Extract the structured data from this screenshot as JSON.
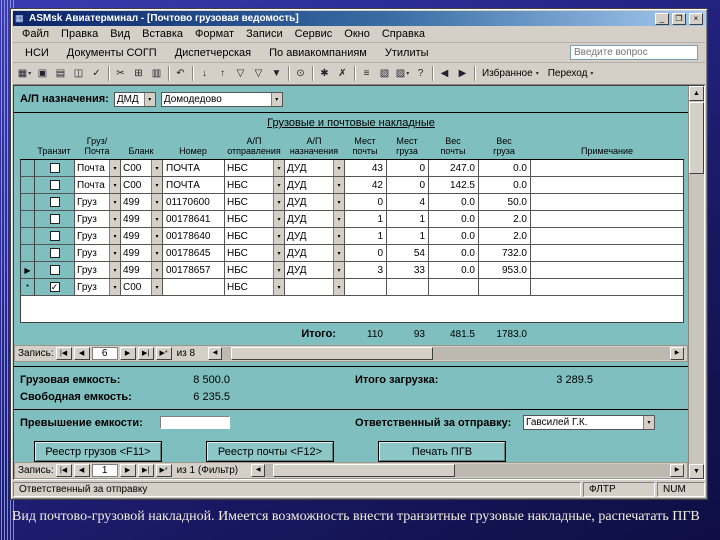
{
  "colors": {
    "slide_background": "#26268a",
    "form_background": "#7fbfbf",
    "titlebar_start": "#0a246a",
    "titlebar_end": "#a6caf0",
    "chrome": "#d4d0c8"
  },
  "window": {
    "title": "ASMsk Авиатерминал - [Почтово грузовая ведомость]",
    "app_icon_glyph": "▦",
    "controls": {
      "minimize": "_",
      "restore": "❐",
      "close": "×"
    }
  },
  "menubar": {
    "items": [
      "Файл",
      "Правка",
      "Вид",
      "Вставка",
      "Формат",
      "Записи",
      "Сервис",
      "Окно",
      "Справка"
    ]
  },
  "menubar2": {
    "items": [
      "НСИ",
      "Документы СОГП",
      "Диспетчерская",
      "По авиакомпаниям",
      "Утилиты"
    ],
    "search_placeholder": "Введите вопрос"
  },
  "toolbar": {
    "icons": [
      {
        "name": "view-icon",
        "glyph": "▦",
        "dropdown": true
      },
      {
        "name": "save-icon",
        "glyph": "▣"
      },
      {
        "name": "print-icon",
        "glyph": "▤"
      },
      {
        "name": "print-preview-icon",
        "glyph": "◫"
      },
      {
        "name": "spelling-icon",
        "glyph": "✓"
      },
      {
        "name": "separator"
      },
      {
        "name": "cut-icon",
        "glyph": "✂"
      },
      {
        "name": "copy-icon",
        "glyph": "⊞"
      },
      {
        "name": "paste-icon",
        "glyph": "▥"
      },
      {
        "name": "separator"
      },
      {
        "name": "undo-icon",
        "glyph": "↶"
      },
      {
        "name": "separator"
      },
      {
        "name": "sort-ascending-icon",
        "glyph": "↓"
      },
      {
        "name": "sort-descending-icon",
        "glyph": "↑"
      },
      {
        "name": "filter-by-selection-icon",
        "glyph": "▽"
      },
      {
        "name": "filter-by-form-icon",
        "glyph": "▽"
      },
      {
        "name": "apply-filter-icon",
        "glyph": "▼"
      },
      {
        "name": "separator"
      },
      {
        "name": "find-icon",
        "glyph": "⊙"
      },
      {
        "name": "separator"
      },
      {
        "name": "new-record-icon",
        "glyph": "✱"
      },
      {
        "name": "delete-record-icon",
        "glyph": "✗"
      },
      {
        "name": "separator"
      },
      {
        "name": "properties-icon",
        "glyph": "≡"
      },
      {
        "name": "database-window-icon",
        "glyph": "▧"
      },
      {
        "name": "new-object-icon",
        "glyph": "▨",
        "dropdown": true
      },
      {
        "name": "help-icon",
        "glyph": "?"
      },
      {
        "name": "separator"
      },
      {
        "name": "back-icon",
        "glyph": "◀"
      },
      {
        "name": "forward-icon",
        "glyph": "▶"
      },
      {
        "name": "separator"
      }
    ],
    "dropdowns": [
      {
        "name": "favorites-dropdown",
        "label": "Избранное"
      },
      {
        "name": "go-dropdown",
        "label": "Переход"
      }
    ]
  },
  "form": {
    "dest_label": "А/П назначения:",
    "dest_code": "ДМД",
    "dest_name": "Домодедово",
    "table_title": "Грузовые и почтовые накладные",
    "table": {
      "headers": [
        "Транзит",
        "Груз/\nПочта",
        "Бланк",
        "Номер",
        "А/П\nотправления",
        "А/П\nназначения",
        "Мест\nпочты",
        "Мест\nгруза",
        "Вес\nпочты",
        "Вес\nгруза",
        "Примечание"
      ],
      "rows": [
        {
          "marker": "",
          "transit": false,
          "type": "Почта",
          "blank": "C00",
          "number": "ПОЧТА",
          "from": "НБС",
          "to": "ДУД",
          "mest_pochty": "43",
          "mest_gruza": "0",
          "ves_pochty": "247.0",
          "ves_gruza": "0.0",
          "note": ""
        },
        {
          "marker": "",
          "transit": false,
          "type": "Почта",
          "blank": "C00",
          "number": "ПОЧТА",
          "from": "НБС",
          "to": "ДУД",
          "mest_pochty": "42",
          "mest_gruza": "0",
          "ves_pochty": "142.5",
          "ves_gruza": "0.0",
          "note": ""
        },
        {
          "marker": "",
          "transit": false,
          "type": "Груз",
          "blank": "499",
          "number": "01170600",
          "from": "НБС",
          "to": "ДУД",
          "mest_pochty": "0",
          "mest_gruza": "4",
          "ves_pochty": "0.0",
          "ves_gruza": "50.0",
          "note": ""
        },
        {
          "marker": "",
          "transit": false,
          "type": "Груз",
          "blank": "499",
          "number": "00178641",
          "from": "НБС",
          "to": "ДУД",
          "mest_pochty": "1",
          "mest_gruza": "1",
          "ves_pochty": "0.0",
          "ves_gruza": "2.0",
          "note": ""
        },
        {
          "marker": "",
          "transit": false,
          "type": "Груз",
          "blank": "499",
          "number": "00178640",
          "from": "НБС",
          "to": "ДУД",
          "mest_pochty": "1",
          "mest_gruza": "1",
          "ves_pochty": "0.0",
          "ves_gruza": "2.0",
          "note": ""
        },
        {
          "marker": "",
          "transit": false,
          "type": "Груз",
          "blank": "499",
          "number": "00178645",
          "from": "НБС",
          "to": "ДУД",
          "mest_pochty": "0",
          "mest_gruza": "54",
          "ves_pochty": "0.0",
          "ves_gruza": "732.0",
          "note": ""
        },
        {
          "marker": "▶",
          "transit": false,
          "type": "Груз",
          "blank": "499",
          "number": "00178657",
          "from": "НБС",
          "to": "ДУД",
          "mest_pochty": "3",
          "mest_gruza": "33",
          "ves_pochty": "0.0",
          "ves_gruza": "953.0",
          "note": ""
        },
        {
          "marker": "*",
          "transit": true,
          "type": "Груз",
          "blank": "C00",
          "number": "",
          "from": "НБС",
          "to": "",
          "mest_pochty": "",
          "mest_gruza": "",
          "ves_pochty": "",
          "ves_gruza": "",
          "note": ""
        }
      ],
      "totals": {
        "label": "Итого:",
        "mest_pochty": "110",
        "mest_gruza": "93",
        "ves_pochty": "481.5",
        "ves_gruza": "1783.0"
      }
    },
    "nav_top": {
      "label": "Запись:",
      "current": "6",
      "of": "из 8"
    },
    "capacity": {
      "cargo_label": "Грузовая емкость:",
      "cargo_value": "8 500.0",
      "free_label": "Свободная емкость:",
      "free_value": "6 235.5",
      "total_label": "Итого загрузка:",
      "total_value": "3 289.5",
      "excess_label": "Превышение емкости:",
      "responsible_label": "Ответственный за отправку:",
      "responsible_value": "Гавсилей  Г.К."
    },
    "buttons": [
      "Реестр грузов <F11>",
      "Реестр почты <F12>",
      "Печать ПГВ"
    ],
    "nav_bottom": {
      "label": "Запись:",
      "current": "1",
      "of": "из 1 (Фильтр)"
    }
  },
  "nav_glyphs": {
    "first": "|◀",
    "prev": "◀",
    "next": "▶",
    "last": "▶|",
    "new": "▶*"
  },
  "scroll_glyphs": {
    "left": "◀",
    "right": "▶",
    "up": "▲",
    "down": "▼"
  },
  "check_glyph": "✓",
  "combo_arrow": "▾",
  "statusbar": {
    "left": "Ответственный за отправку",
    "filter": "ФЛТР",
    "num": "NUM"
  },
  "caption": "Вид почтово-грузовой накладной. Имеется возможность внести транзитные грузовые накладные, распечатать ПГВ"
}
